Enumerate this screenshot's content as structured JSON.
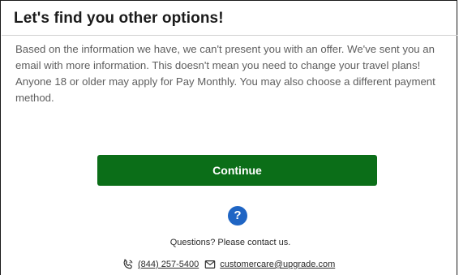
{
  "dialog": {
    "title": "Let's find you other options!",
    "message": "Based on the information we have, we can't present you with an offer. We've sent you an email with more information. This doesn't mean you need to change your travel plans! Anyone 18 or older may apply for Pay Monthly. You may also choose a different payment method."
  },
  "actions": {
    "continue_label": "Continue"
  },
  "help": {
    "icon_glyph": "?",
    "questions_text": "Questions? Please contact us.",
    "phone": "(844) 257-5400",
    "email": "customercare@upgrade.com"
  },
  "colors": {
    "primary_button": "#0b6e18",
    "help_icon": "#1f65c4"
  },
  "icons": {
    "phone": "phone-icon",
    "mail": "mail-icon",
    "help": "question-circle-icon"
  }
}
